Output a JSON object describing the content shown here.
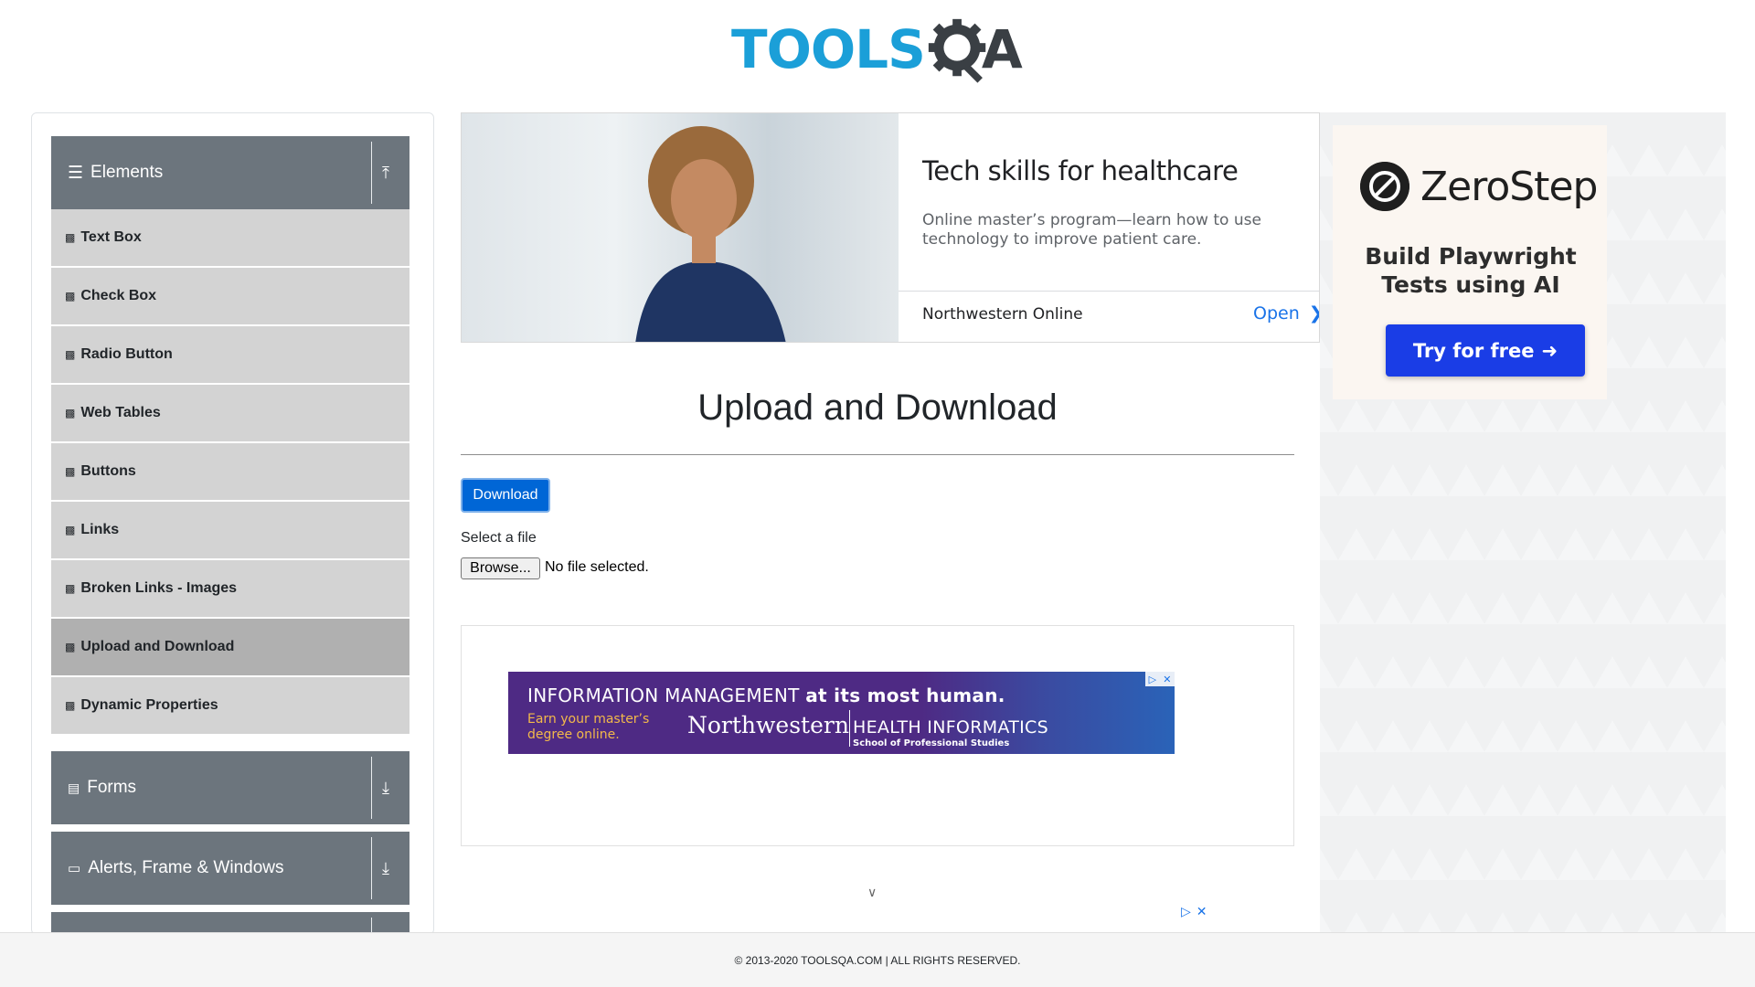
{
  "logo": {
    "text": "TOOLS",
    "tail": "A"
  },
  "sidebar": {
    "elements_header": {
      "label": "Elements",
      "icon": "hamburger-icon",
      "arrow": "collapse-up-icon"
    },
    "items": [
      {
        "label": "Text Box"
      },
      {
        "label": "Check Box"
      },
      {
        "label": "Radio Button"
      },
      {
        "label": "Web Tables"
      },
      {
        "label": "Buttons"
      },
      {
        "label": "Links"
      },
      {
        "label": "Broken Links - Images"
      },
      {
        "label": "Upload and Download",
        "active": true
      },
      {
        "label": "Dynamic Properties"
      }
    ],
    "groups": [
      {
        "label": "Forms",
        "icon": "form-icon"
      },
      {
        "label": "Alerts, Frame & Windows",
        "icon": "window-icon"
      }
    ]
  },
  "banner_ad": {
    "title": "Tech skills for healthcare",
    "description": "Online master’s program—learn how to use technology to improve patient care.",
    "brand": "Northwestern Online",
    "cta": "Open"
  },
  "main": {
    "title": "Upload and Download",
    "download_label": "Download",
    "file_label": "Select a file",
    "browse_label": "Browse...",
    "no_file_text": "No file selected."
  },
  "inner_ad": {
    "headline_normal": "INFORMATION MANAGEMENT ",
    "headline_bold": "at its most human.",
    "sub": "Earn your master’s degree online.",
    "brand": "Northwestern",
    "program": "HEALTH INFORMATICS",
    "school": "School of Professional Studies"
  },
  "right_ad": {
    "brand": "ZeroStep",
    "tagline": "Build Playwright Tests using AI",
    "cta": "Try for free"
  },
  "footer": {
    "text": "© 2013-2020 TOOLSQA.COM | ALL RIGHTS RESERVED."
  },
  "colors": {
    "brand_blue": "#1b9fd8",
    "sidebar_header": "#6c757d",
    "menu_bg": "#d3d3d3",
    "primary_button": "#0066d6",
    "cta_blue": "#1a3de6"
  }
}
